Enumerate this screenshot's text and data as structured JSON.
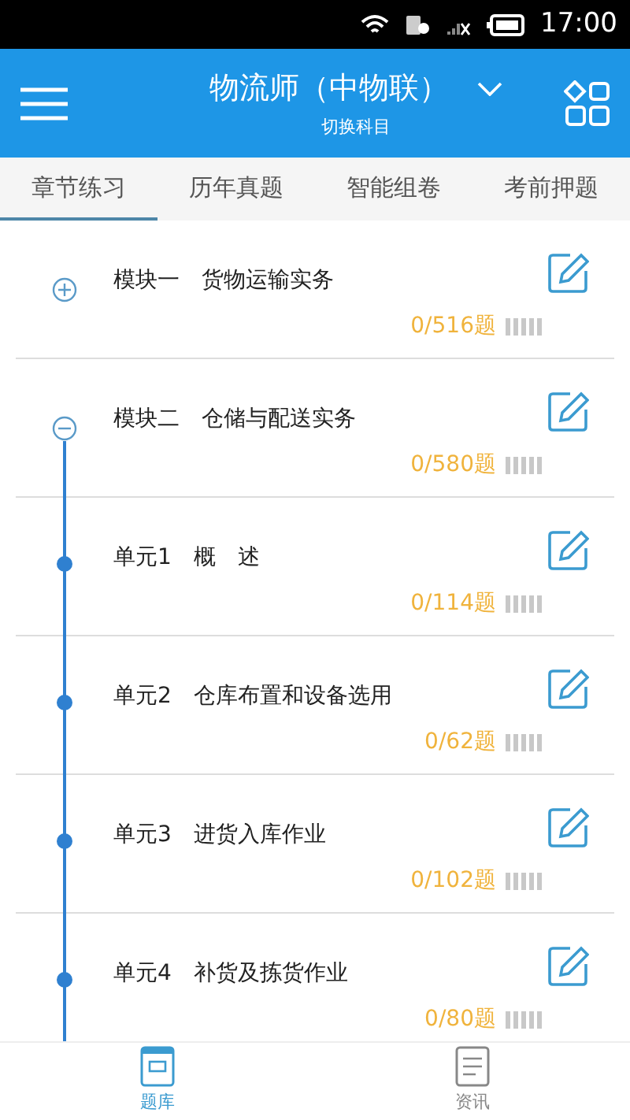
{
  "status_bar": {
    "time": "17:00"
  },
  "header": {
    "title": "物流师（中物联）",
    "subtitle": "切换科目"
  },
  "tabs": [
    {
      "label": "章节练习",
      "selected": true
    },
    {
      "label": "历年真题",
      "selected": false
    },
    {
      "label": "智能组卷",
      "selected": false
    },
    {
      "label": "考前押题",
      "selected": false
    }
  ],
  "chapters": [
    {
      "kind": "module",
      "title": "模块一　货物运输实务",
      "count": "0/516题",
      "expanded": false
    },
    {
      "kind": "module",
      "title": "模块二　仓储与配送实务",
      "count": "0/580题",
      "expanded": true
    },
    {
      "kind": "unit",
      "title": "单元1　概　述",
      "count": "0/114题"
    },
    {
      "kind": "unit",
      "title": "单元2　仓库布置和设备选用",
      "count": "0/62题"
    },
    {
      "kind": "unit",
      "title": "单元3　进货入库作业",
      "count": "0/102题"
    },
    {
      "kind": "unit",
      "title": "单元4　补货及拣货作业",
      "count": "0/80题"
    }
  ],
  "bottom_nav": [
    {
      "label": "题库",
      "selected": true
    },
    {
      "label": "资讯",
      "selected": false
    }
  ]
}
